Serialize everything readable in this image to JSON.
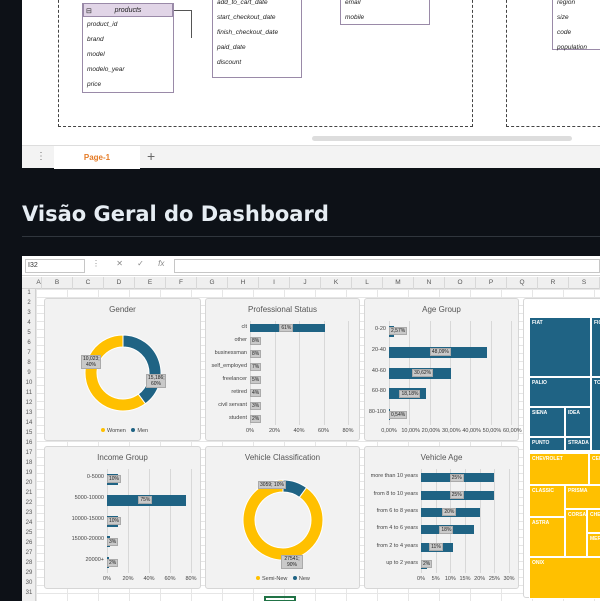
{
  "drawio": {
    "products_table": {
      "title": "products",
      "fields": [
        "product_id",
        "brand",
        "model",
        "modelo_year",
        "price"
      ]
    },
    "checkout_fields": [
      "add_to_cart_date",
      "start_checkout_date",
      "finish_checkout_date",
      "paid_date",
      "discount"
    ],
    "customer_fields": [
      "email",
      "mobile"
    ],
    "location_fields": [
      "region",
      "size",
      "code",
      "population"
    ],
    "tab_label": "Page-1",
    "add_tab": "+",
    "menu_icon": "⋮"
  },
  "heading": "Visão Geral do Dashboard",
  "excel": {
    "namebox": "I32",
    "fx_label": "fx",
    "columns": [
      "A",
      "B",
      "C",
      "D",
      "E",
      "F",
      "G",
      "H",
      "I",
      "J",
      "K",
      "L",
      "M",
      "N",
      "O",
      "P",
      "Q",
      "R",
      "S"
    ],
    "rows": [
      "1",
      "2",
      "3",
      "4",
      "5",
      "6",
      "7",
      "8",
      "9",
      "10",
      "11",
      "12",
      "13",
      "14",
      "15",
      "16",
      "17",
      "18",
      "19",
      "20",
      "21",
      "22",
      "23",
      "24",
      "25",
      "26",
      "27",
      "28",
      "29",
      "30",
      "31"
    ]
  },
  "charts": {
    "gender": {
      "title": "Gender",
      "slices": [
        {
          "name": "Women",
          "label": "15,186; 60%",
          "fraction": 0.6,
          "color": "#ffc000"
        },
        {
          "name": "Men",
          "label": "10,023; 40%",
          "fraction": 0.4,
          "color": "#1f6384"
        }
      ]
    },
    "professional": {
      "title": "Professional Status",
      "categories": [
        "clt",
        "other",
        "businessman",
        "self_employed",
        "freelancer",
        "retired",
        "civil servant",
        "student"
      ],
      "values": [
        0.61,
        0.08,
        0.08,
        0.07,
        0.05,
        0.04,
        0.03,
        0.02
      ],
      "labels": [
        "61%",
        "8%",
        "8%",
        "7%",
        "5%",
        "4%",
        "3%",
        "2%"
      ],
      "ticks": [
        "0%",
        "20%",
        "40%",
        "60%",
        "80%"
      ],
      "xmax": 0.8
    },
    "age": {
      "title": "Age Group",
      "categories": [
        "0-20",
        "20-40",
        "40-60",
        "60-80",
        "80-100"
      ],
      "values": [
        0.0257,
        0.4809,
        0.3062,
        0.1818,
        0.0054
      ],
      "labels": [
        "2,57%",
        "48,09%",
        "30,62%",
        "18,18%",
        "0,54%"
      ],
      "ticks": [
        "0,00%",
        "10,00%",
        "20,00%",
        "30,00%",
        "40,00%",
        "50,00%",
        "60,00%"
      ],
      "xmax": 0.6
    },
    "income": {
      "title": "Income Group",
      "categories": [
        "0-5000",
        "5000-10000",
        "10000-15000",
        "15000-20000",
        "20000+"
      ],
      "values": [
        0.1,
        0.75,
        0.1,
        0.03,
        0.02
      ],
      "labels": [
        "10%",
        "75%",
        "10%",
        "3%",
        "2%"
      ],
      "ticks": [
        "0%",
        "20%",
        "40%",
        "60%",
        "80%"
      ],
      "xmax": 0.8
    },
    "vehicle_class": {
      "title": "Vehicle Classification",
      "slices": [
        {
          "name": "Semi-New",
          "label": "27541; 90%",
          "fraction": 0.9,
          "color": "#ffc000"
        },
        {
          "name": "New",
          "label": "3059; 10%",
          "fraction": 0.1,
          "color": "#1f6384"
        }
      ]
    },
    "vehicle_age": {
      "title": "Vehicle Age",
      "categories": [
        "more than 10 years",
        "from 8 to 10 years",
        "from 6 to 8 years",
        "from 4 to 6 years",
        "from 2 to 4 years",
        "up to 2 years"
      ],
      "values": [
        0.25,
        0.25,
        0.2,
        0.18,
        0.11,
        0.02
      ],
      "labels": [
        "25%",
        "25%",
        "20%",
        "18%",
        "11%",
        "2%"
      ],
      "ticks": [
        "0%",
        "5%",
        "10%",
        "15%",
        "20%",
        "25%",
        "30%"
      ],
      "xmax": 0.3
    },
    "treemap": {
      "blue_labels": [
        "FIAT",
        "PALIO",
        "SIENA",
        "IDEA",
        "PUNTO",
        "STRADA",
        "TO...",
        "FIO..."
      ],
      "yellow_labels": [
        "CHEVROLET",
        "CELTA",
        "CLASSIC",
        "PRISMA",
        "ASTRA",
        "CORSA",
        "CHE...",
        "MER...",
        "ONIX"
      ]
    }
  }
}
